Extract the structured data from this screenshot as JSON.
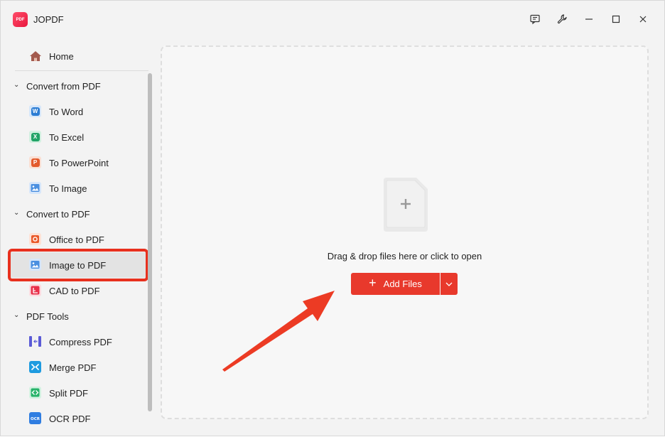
{
  "app": {
    "title": "JOPDF",
    "logo_text": "PDF"
  },
  "titlebar": {
    "buttons": [
      {
        "name": "feedback-icon"
      },
      {
        "name": "settings-wrench-icon"
      },
      {
        "name": "minimize-icon"
      },
      {
        "name": "maximize-icon"
      },
      {
        "name": "close-icon"
      }
    ]
  },
  "sidebar": {
    "home": {
      "label": "Home",
      "icon": "home-icon"
    },
    "sections": [
      {
        "label": "Convert from PDF",
        "items": [
          {
            "label": "To Word",
            "icon": "word-icon",
            "glyph": "W",
            "color": "#2b7cd3"
          },
          {
            "label": "To Excel",
            "icon": "excel-icon",
            "glyph": "X",
            "color": "#21a366"
          },
          {
            "label": "To PowerPoint",
            "icon": "powerpoint-icon",
            "glyph": "P",
            "color": "#e35a2c"
          },
          {
            "label": "To Image",
            "icon": "image-icon",
            "glyph": "",
            "color": "#4a8fe0"
          }
        ]
      },
      {
        "label": "Convert to PDF",
        "items": [
          {
            "label": "Office to PDF",
            "icon": "office-icon",
            "glyph": "O",
            "color": "#ea5a2a"
          },
          {
            "label": "Image to PDF",
            "icon": "image-icon",
            "glyph": "",
            "color": "#4a8fe0",
            "selected": true
          },
          {
            "label": "CAD to PDF",
            "icon": "cad-icon",
            "glyph": "",
            "color": "#e8304a"
          }
        ]
      },
      {
        "label": "PDF Tools",
        "items": [
          {
            "label": "Compress PDF",
            "icon": "compress-icon",
            "glyph": "",
            "color": "#5b5bd6"
          },
          {
            "label": "Merge PDF",
            "icon": "merge-icon",
            "glyph": "",
            "color": "#1e9be0"
          },
          {
            "label": "Split PDF",
            "icon": "split-icon",
            "glyph": "",
            "color": "#27b36a"
          },
          {
            "label": "OCR PDF",
            "icon": "ocr-icon",
            "glyph": "",
            "color": "#2f7de1"
          }
        ]
      }
    ]
  },
  "main": {
    "drop_text": "Drag & drop files here or click to open",
    "add_files_label": "Add Files"
  },
  "colors": {
    "accent": "#e8392c",
    "annotation": "#e8301e"
  }
}
